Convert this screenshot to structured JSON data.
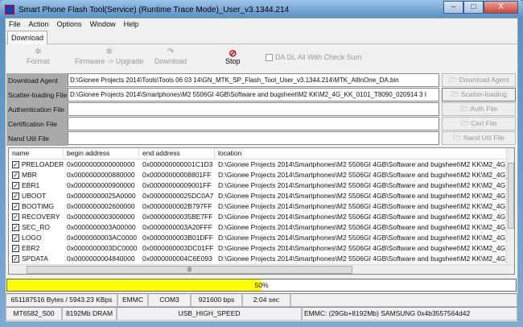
{
  "window": {
    "title": "Smart Phone Flash Tool(Service) (Runtime Trace Mode)_User_v3.1344.214",
    "minimize": "–",
    "maximize": "□",
    "close": "X"
  },
  "menu": [
    "File",
    "Action",
    "Options",
    "Window",
    "Help"
  ],
  "tab": "Download",
  "toolbar": {
    "format": "Format",
    "firmware_upgrade": "Firmware -> Upgrade",
    "download": "Download",
    "stop": "Stop",
    "checksum_label": "DA DL All With Check Sum"
  },
  "files": [
    {
      "label": "Download Agent",
      "value": "D:\\Gionee Projects 2014\\Tools\\Tools 06 03 14\\GN_MTK_SP_Flash_Tool_User_v3.1344.214\\MTK_AllInOne_DA.bin",
      "button": "Download Agent"
    },
    {
      "label": "Scatter-loading File",
      "value": "D:\\Gionee Projects 2014\\Smartphones\\M2 5506GI 4GB\\Software and bugsheet\\M2 KK\\M2_4G_KK_0101_T8090_020914 3 I",
      "button": "Scatter-loading"
    },
    {
      "label": "Authentication File",
      "value": "",
      "button": "Auth File"
    },
    {
      "label": "Certification File",
      "value": "",
      "button": "Cert File"
    },
    {
      "label": "Nand Util File",
      "value": "",
      "button": "Nand Util File"
    }
  ],
  "table": {
    "headers": [
      "name",
      "begin address",
      "end address",
      "location"
    ],
    "rows": [
      [
        "PRELOADER",
        "0x0000000000000000",
        "0x000000000001C1D3",
        "D:\\Gionee Projects 2014\\Smartphones\\M2 5506GI 4GB\\Software and bugsheet\\M2 KK\\M2_4G_"
      ],
      [
        "MBR",
        "0x0000000000880000",
        "0x00000000008801FF",
        "D:\\Gionee Projects 2014\\Smartphones\\M2 5506GI 4GB\\Software and bugsheet\\M2 KK\\M2_4G_"
      ],
      [
        "EBR1",
        "0x0000000000900000",
        "0x00000000009001FF",
        "D:\\Gionee Projects 2014\\Smartphones\\M2 5506GI 4GB\\Software and bugsheet\\M2 KK\\M2_4G_"
      ],
      [
        "UBOOT",
        "0x00000000025A0000",
        "0x00000000025DC0A7",
        "D:\\Gionee Projects 2014\\Smartphones\\M2 5506GI 4GB\\Software and bugsheet\\M2 KK\\M2_4G_"
      ],
      [
        "BOOTIMG",
        "0x0000000002600000",
        "0x0000000002B797FF",
        "D:\\Gionee Projects 2014\\Smartphones\\M2 5506GI 4GB\\Software and bugsheet\\M2 KK\\M2_4G_"
      ],
      [
        "RECOVERY",
        "0x0000000003000000",
        "0x00000000035BE7FF",
        "D:\\Gionee Projects 2014\\Smartphones\\M2 5506GI 4GB\\Software and bugsheet\\M2 KK\\M2_4G_"
      ],
      [
        "SEC_RO",
        "0x0000000003A00000",
        "0x0000000003A20FFF",
        "D:\\Gionee Projects 2014\\Smartphones\\M2 5506GI 4GB\\Software and bugsheet\\M2 KK\\M2_4G_"
      ],
      [
        "LOGO",
        "0x0000000003AC0000",
        "0x0000000003B01DFF",
        "D:\\Gionee Projects 2014\\Smartphones\\M2 5506GI 4GB\\Software and bugsheet\\M2 KK\\M2_4G_"
      ],
      [
        "EBR2",
        "0x0000000003DC0000",
        "0x0000000003DC01FF",
        "D:\\Gionee Projects 2014\\Smartphones\\M2 5506GI 4GB\\Software and bugsheet\\M2 KK\\M2_4G_"
      ],
      [
        "SPDATA",
        "0x0000000004840000",
        "0x0000000004C6E093",
        "D:\\Gionee Projects 2014\\Smartphones\\M2 5506GI 4GB\\Software and bugsheet\\M2 KK\\M2_4G_"
      ]
    ]
  },
  "progress": {
    "percent": 50,
    "label": "50%",
    "color": "#ffff00"
  },
  "status1": [
    "651187516 Bytes / 5943.23 KBps",
    "EMMC",
    "COM3",
    "921600 bps",
    "2:04 sec",
    ""
  ],
  "status2": [
    "MT6582_S00",
    "8192Mb DRAM",
    "USB_HIGH_SPEED",
    "EMMC: (29Gb+8192Mb) SAMSUNG 0x4b3557564d42"
  ]
}
